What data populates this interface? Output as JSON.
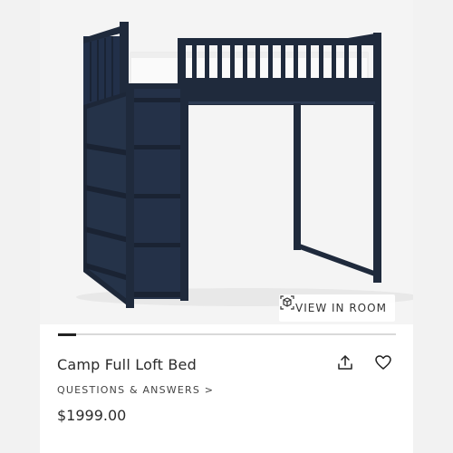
{
  "product": {
    "title": "Camp Full Loft Bed",
    "qa_link": "QUESTIONS & ANSWERS >",
    "price": "$1999.00"
  },
  "image": {
    "view_in_room_label": "VIEW IN ROOM"
  },
  "carousel": {
    "active_index": 0
  },
  "icons": {
    "share": "share-icon",
    "favorite": "heart-icon",
    "view_in_room": "ar-cube-icon"
  },
  "colors": {
    "bed": "#1f2a3c",
    "background": "#f4f4f4"
  }
}
